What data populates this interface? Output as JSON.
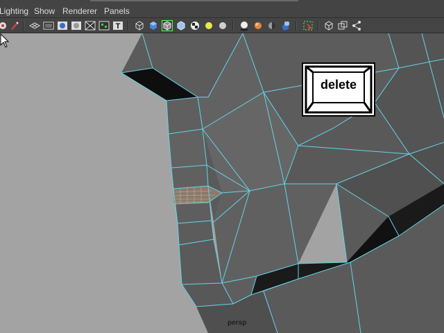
{
  "menu": {
    "items": [
      "Lighting",
      "Show",
      "Renderer",
      "Panels"
    ]
  },
  "toolbar": {
    "icons": [
      "camera-attributes-icon",
      "image-plane-icon",
      "grid-icon",
      "film-gate-icon",
      "resolution-gate-icon",
      "gate-mask-icon",
      "field-chart-icon",
      "safe-action-icon",
      "safe-title-icon",
      "wireframe-icon",
      "smooth-shade-icon",
      "wireframe-on-shaded-icon",
      "default-material-icon",
      "textured-icon",
      "use-default-light-icon",
      "all-lights-icon",
      "shadows-icon",
      "high-quality-icon",
      "xray-icon",
      "xray-joints-icon",
      "isolate-select-icon",
      "bounding-box-icon",
      "two-sided-lighting-icon",
      "hierarchy-icon"
    ]
  },
  "viewport": {
    "camera_label": "persp",
    "overlay_key_label": "delete"
  },
  "colors": {
    "background": "#a3a3a3",
    "mesh_face": "#5d5d5d",
    "mesh_edge": "#63d6e9",
    "dark_face": "#0e0e0e"
  }
}
